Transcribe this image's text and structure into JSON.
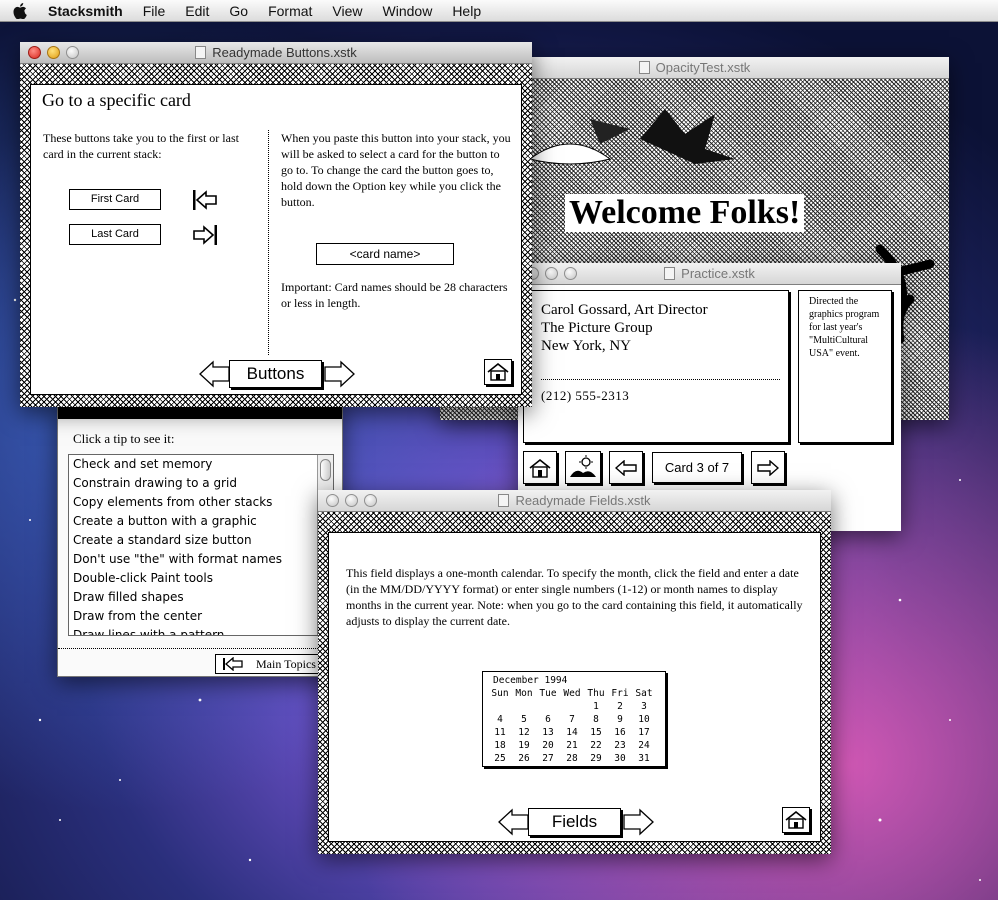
{
  "menubar": {
    "app_name": "Stacksmith",
    "items": [
      "File",
      "Edit",
      "Go",
      "Format",
      "View",
      "Window",
      "Help"
    ]
  },
  "opacity_window": {
    "title": "OpacityTest.xstk",
    "welcome_text": "Welcome Folks!"
  },
  "practice_window": {
    "title": "Practice.xstk",
    "card_text": {
      "line1": "Carol Gossard, Art Director",
      "line2": "The Picture Group",
      "line3": "New York, NY",
      "phone": "(212) 555-2313"
    },
    "side_note": "Directed the graphics program  for last year's \"MultiCultural USA\" event.",
    "nav": {
      "card_counter": "Card 3 of 7",
      "home_icon": "home-icon",
      "paint_icon": "landscape-icon",
      "prev_icon": "left-arrow-icon",
      "next_icon": "right-arrow-icon"
    }
  },
  "tips_window": {
    "prompt": "Click a tip to see it:",
    "tips": [
      "Check and set memory",
      "Constrain drawing to a grid",
      "Copy elements from other stacks",
      "Create a button with a graphic",
      "Create a standard size button",
      "Don't use \"the\" with format names",
      "Double-click Paint tools",
      "Draw filled shapes",
      "Draw from the center",
      "Draw lines with a pattern"
    ],
    "main_topics_label": "Main Topics"
  },
  "buttons_window": {
    "title": "Readymade Buttons.xstk",
    "heading": "Go to a specific card",
    "left_text": "These buttons take you to the first or last card in the current stack:",
    "first_card_label": "First Card",
    "last_card_label": "Last Card",
    "right_text": "When you paste this button into your stack, you will be asked to select a card for the button to go to. To change the card the button goes to, hold down the Option key while you click the button.",
    "card_name_label": "<card name>",
    "important_text": "Important: Card names should be 28 characters or less in length.",
    "nav_label": "Buttons"
  },
  "fields_window": {
    "title": "Readymade Fields.xstk",
    "description": "This field displays a one-month calendar. To specify the month, click the field and enter a date (in the MM/DD/YYYY format) or enter single numbers (1-12) or month names to display months in the current year. Note: when you go to the card containing this field, it automatically adjusts to display the current date.",
    "calendar": {
      "month_label": "December 1994",
      "day_headers": [
        "Sun",
        "Mon",
        "Tue",
        "Wed",
        "Thu",
        "Fri",
        "Sat"
      ],
      "weeks": [
        [
          "",
          "",
          "",
          "",
          "1",
          "2",
          "3"
        ],
        [
          "4",
          "5",
          "6",
          "7",
          "8",
          "9",
          "10"
        ],
        [
          "11",
          "12",
          "13",
          "14",
          "15",
          "16",
          "17"
        ],
        [
          "18",
          "19",
          "20",
          "21",
          "22",
          "23",
          "24"
        ],
        [
          "25",
          "26",
          "27",
          "28",
          "29",
          "30",
          "31"
        ]
      ]
    },
    "nav_label": "Fields"
  }
}
